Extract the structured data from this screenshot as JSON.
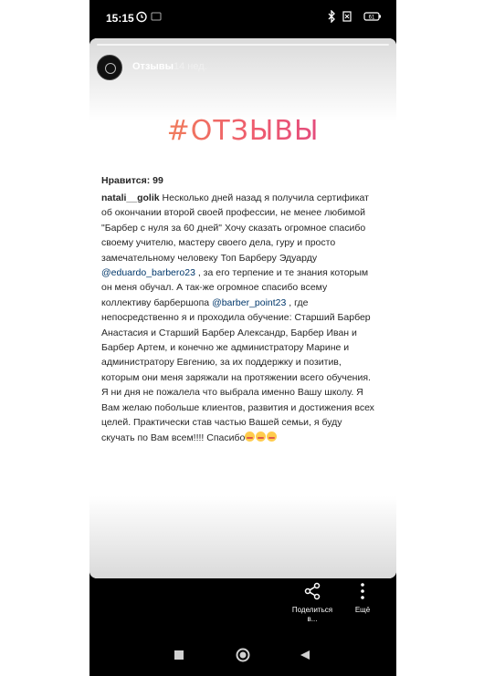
{
  "status_bar": {
    "time": "15:15",
    "battery": "61"
  },
  "story": {
    "username": "Отзывы",
    "time_ago": "14 нед.",
    "hashtag": "#ОТЗЫВЫ"
  },
  "post": {
    "likes": "Нравится: 99",
    "author": "natali__golik",
    "seg1": " Несколько дней назад я получила сертификат об окончании второй своей профессии, не менее любимой \"Барбер с нуля за 60 дней\" Хочу сказать огромное спасибо своему учителю, мастеру своего дела, гуру и просто замечательному человеку Топ Барберу Эдуарду ",
    "mention1": "@eduardo_barbero23",
    "seg2": " , за его терпение и те знания которым он меня обучал. А так-же огромное спасибо всему коллективу барбершопа ",
    "mention2": "@barber_point23",
    "seg3": " , где непосредственно я и проходила обучение: Старший Барбер Анастасия и Старший Барбер Александр, Барбер Иван и Барбер Артем, и конечно же администратору Марине и администратору Евгению,  за их поддержку и позитив, которым они меня заряжали на протяжении всего обучения. Я ни дня не пожалела что выбрала именно Вашу школу. Я Вам желаю побольше клиентов, развития и достижения всех целей. Практически став частью Вашей семьи, я буду скучать по Вам всем!!!! Спасибо"
  },
  "actions": {
    "share_label": "Поделиться в...",
    "more_label": "Ещё"
  }
}
